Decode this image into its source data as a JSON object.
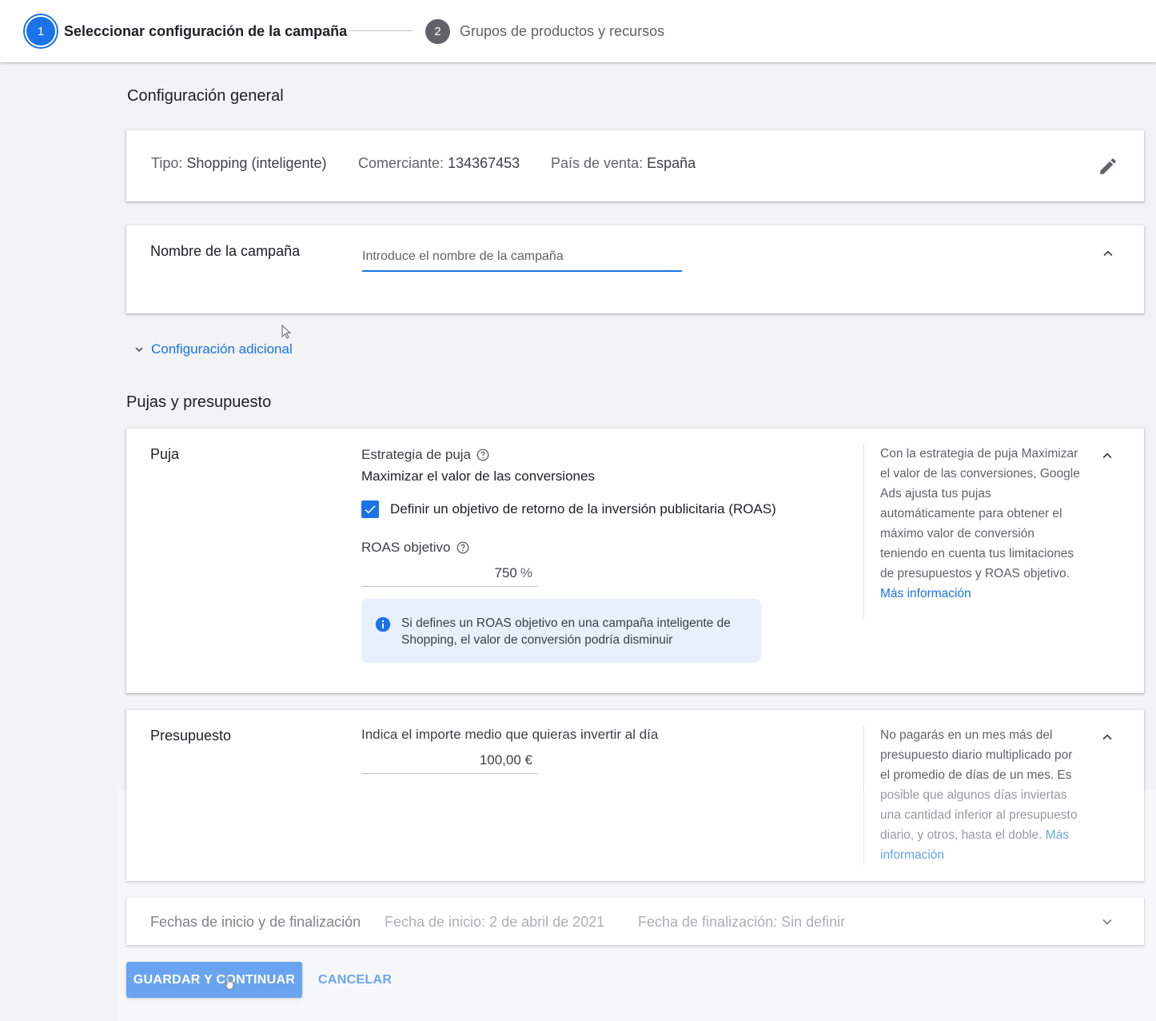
{
  "stepper": {
    "step1": {
      "number": "1",
      "label": "Seleccionar configuración de la campaña"
    },
    "step2": {
      "number": "2",
      "label": "Grupos de productos y recursos"
    }
  },
  "general": {
    "title": "Configuración general",
    "type_label": "Tipo:",
    "type_value": "Shopping (inteligente)",
    "merchant_label": "Comerciante:",
    "merchant_value": "134367453",
    "country_label": "País de venta:",
    "country_value": "España"
  },
  "campaign_name": {
    "label": "Nombre de la campaña",
    "placeholder": "Introduce el nombre de la campaña",
    "value": ""
  },
  "additional_settings": {
    "label": "Configuración adicional"
  },
  "bidding_budget": {
    "title": "Pujas y presupuesto",
    "bid": {
      "label": "Puja",
      "strategy_title": "Estrategia de puja",
      "strategy_value": "Maximizar el valor de las conversiones",
      "checkbox_label": "Definir un objetivo de retorno de la inversión publicitaria (ROAS)",
      "checkbox_checked": true,
      "roas_title": "ROAS objetivo",
      "roas_value": "750",
      "roas_unit": "%",
      "info_text": "Si defines un ROAS objetivo en una campaña inteligente de Shopping, el valor de conversión podría disminuir",
      "side_text": "Con la estrategia de puja Maximizar el valor de las conversiones, Google Ads ajusta tus pujas automáticamente para obtener el máximo valor de conversión teniendo en cuenta tus limitaciones de presupuestos y ROAS objetivo.",
      "side_link": "Más información"
    },
    "budget": {
      "label": "Presupuesto",
      "field_title": "Indica el importe medio que quieras invertir al día",
      "value": "100,00 €",
      "side_text": "No pagarás en un mes más del presupuesto diario multiplicado por el promedio de días de un mes. Es posible que algunos días inviertas una cantidad inferior al presupuesto diario, y otros, hasta el doble.",
      "side_link": "Más información"
    },
    "dates": {
      "label": "Fechas de inicio y de finalización",
      "start": "Fecha de inicio: 2 de abril de 2021",
      "end": "Fecha de finalización: Sin definir"
    }
  },
  "actions": {
    "save_label": "GUARDAR Y CONTINUAR",
    "cancel_label": "CANCELAR"
  },
  "colors": {
    "accent": "#1a73e8",
    "info_background": "#e8f0fe"
  }
}
